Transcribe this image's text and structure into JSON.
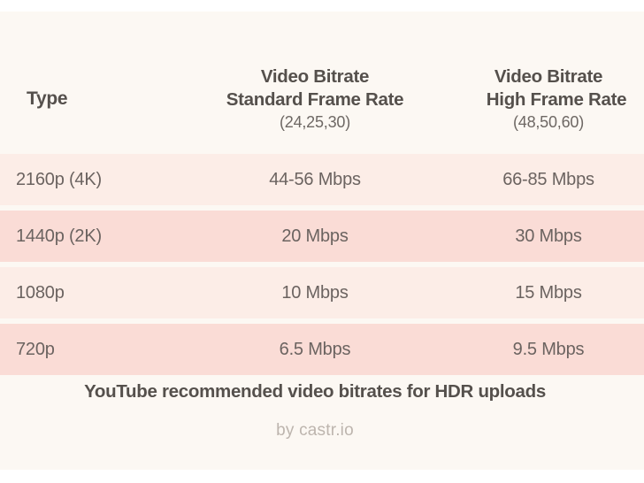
{
  "theme": {
    "background": "#FFFFFF",
    "card_background": "#FCF8F3",
    "row_light": "#FCEDE7",
    "row_dark": "#FADCD6",
    "header_text": "#55504C",
    "body_text": "#6B6360",
    "byline_text": "#BDB5AE"
  },
  "table": {
    "headers": [
      {
        "line1": "Type",
        "line2": "",
        "sub": ""
      },
      {
        "line1": "Video Bitrate",
        "line2": "Standard Frame Rate",
        "sub": "(24,25,30)"
      },
      {
        "line1": "Video Bitrate",
        "line2": "High Frame Rate",
        "sub": "(48,50,60)"
      }
    ],
    "rows": [
      {
        "type": "2160p (4K)",
        "standard": "44-56 Mbps",
        "high": "66-85 Mbps",
        "shade": "light"
      },
      {
        "type": "1440p (2K)",
        "standard": "20 Mbps",
        "high": "30 Mbps",
        "shade": "dark"
      },
      {
        "type": "1080p",
        "standard": "10 Mbps",
        "high": "15 Mbps",
        "shade": "light"
      },
      {
        "type": "720p",
        "standard": "6.5 Mbps",
        "high": "9.5 Mbps",
        "shade": "dark"
      }
    ]
  },
  "caption": "YouTube recommended video bitrates for HDR uploads",
  "byline": "by castr.io",
  "chart_data": {
    "type": "table",
    "title": "YouTube recommended video bitrates for HDR uploads",
    "columns": [
      "Type",
      "Video Bitrate Standard Frame Rate (24,25,30)",
      "Video Bitrate High Frame Rate (48,50,60)"
    ],
    "rows": [
      [
        "2160p (4K)",
        "44-56 Mbps",
        "66-85 Mbps"
      ],
      [
        "1440p (2K)",
        "20 Mbps",
        "30 Mbps"
      ],
      [
        "1080p",
        "10 Mbps",
        "15 Mbps"
      ],
      [
        "720p",
        "6.5 Mbps",
        "9.5 Mbps"
      ]
    ],
    "source": "by castr.io"
  }
}
